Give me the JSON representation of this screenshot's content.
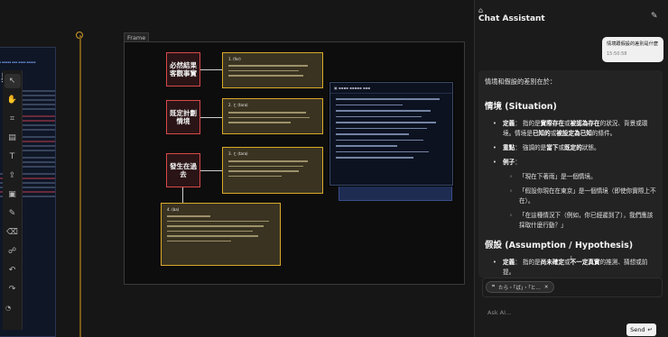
{
  "canvas": {
    "frame_label": "Frame",
    "left_doc_ticker": "▪ ▪▪▪▪▪ ▪▪▪ ▪▪▪▪ ▪▪▪▪▪",
    "left_doc_heading": "與用",
    "tools": [
      {
        "icon": "cursor-icon",
        "glyph": "↖"
      },
      {
        "icon": "hand-icon",
        "glyph": "✋"
      },
      {
        "icon": "frame-icon",
        "glyph": "⌗"
      },
      {
        "icon": "document-icon",
        "glyph": "▤"
      },
      {
        "icon": "text-icon",
        "glyph": "T"
      },
      {
        "icon": "upload-icon",
        "glyph": "⇪"
      },
      {
        "icon": "image-icon",
        "glyph": "▣"
      },
      {
        "icon": "pen-icon",
        "glyph": "✎"
      },
      {
        "icon": "eraser-icon",
        "glyph": "⌫"
      },
      {
        "icon": "link-icon",
        "glyph": "☍"
      },
      {
        "icon": "undo-icon",
        "glyph": "↶"
      },
      {
        "icon": "redo-icon",
        "glyph": "↷"
      }
    ],
    "nodes": [
      {
        "label": "必然結果 客觀事實"
      },
      {
        "label": "既定計劃 情境"
      },
      {
        "label": "發生在過去"
      }
    ],
    "cards": [
      {
        "head": "1. (for)"
      },
      {
        "head": "2. と (tara)"
      },
      {
        "head": "3. と (tara)"
      },
      {
        "head": "4. (ba)"
      }
    ],
    "popup_head": "▣ ▪▪▪▪ ▪▪▪▪▪ ▪▪▪"
  },
  "chat": {
    "title": "Chat Assistant",
    "user_message": "情境跟假設的差別是什麼",
    "user_time": "15:50:58",
    "assistant": {
      "intro": "情境和假設的差別在於：",
      "section1_title": "情境 (Situation)",
      "section2_title": "假設 (Assumption / Hypothesis)"
    },
    "mention_chip": "たら・「ば」・「と…",
    "input_placeholder": "Ask AI...",
    "send_label": "Send"
  }
}
